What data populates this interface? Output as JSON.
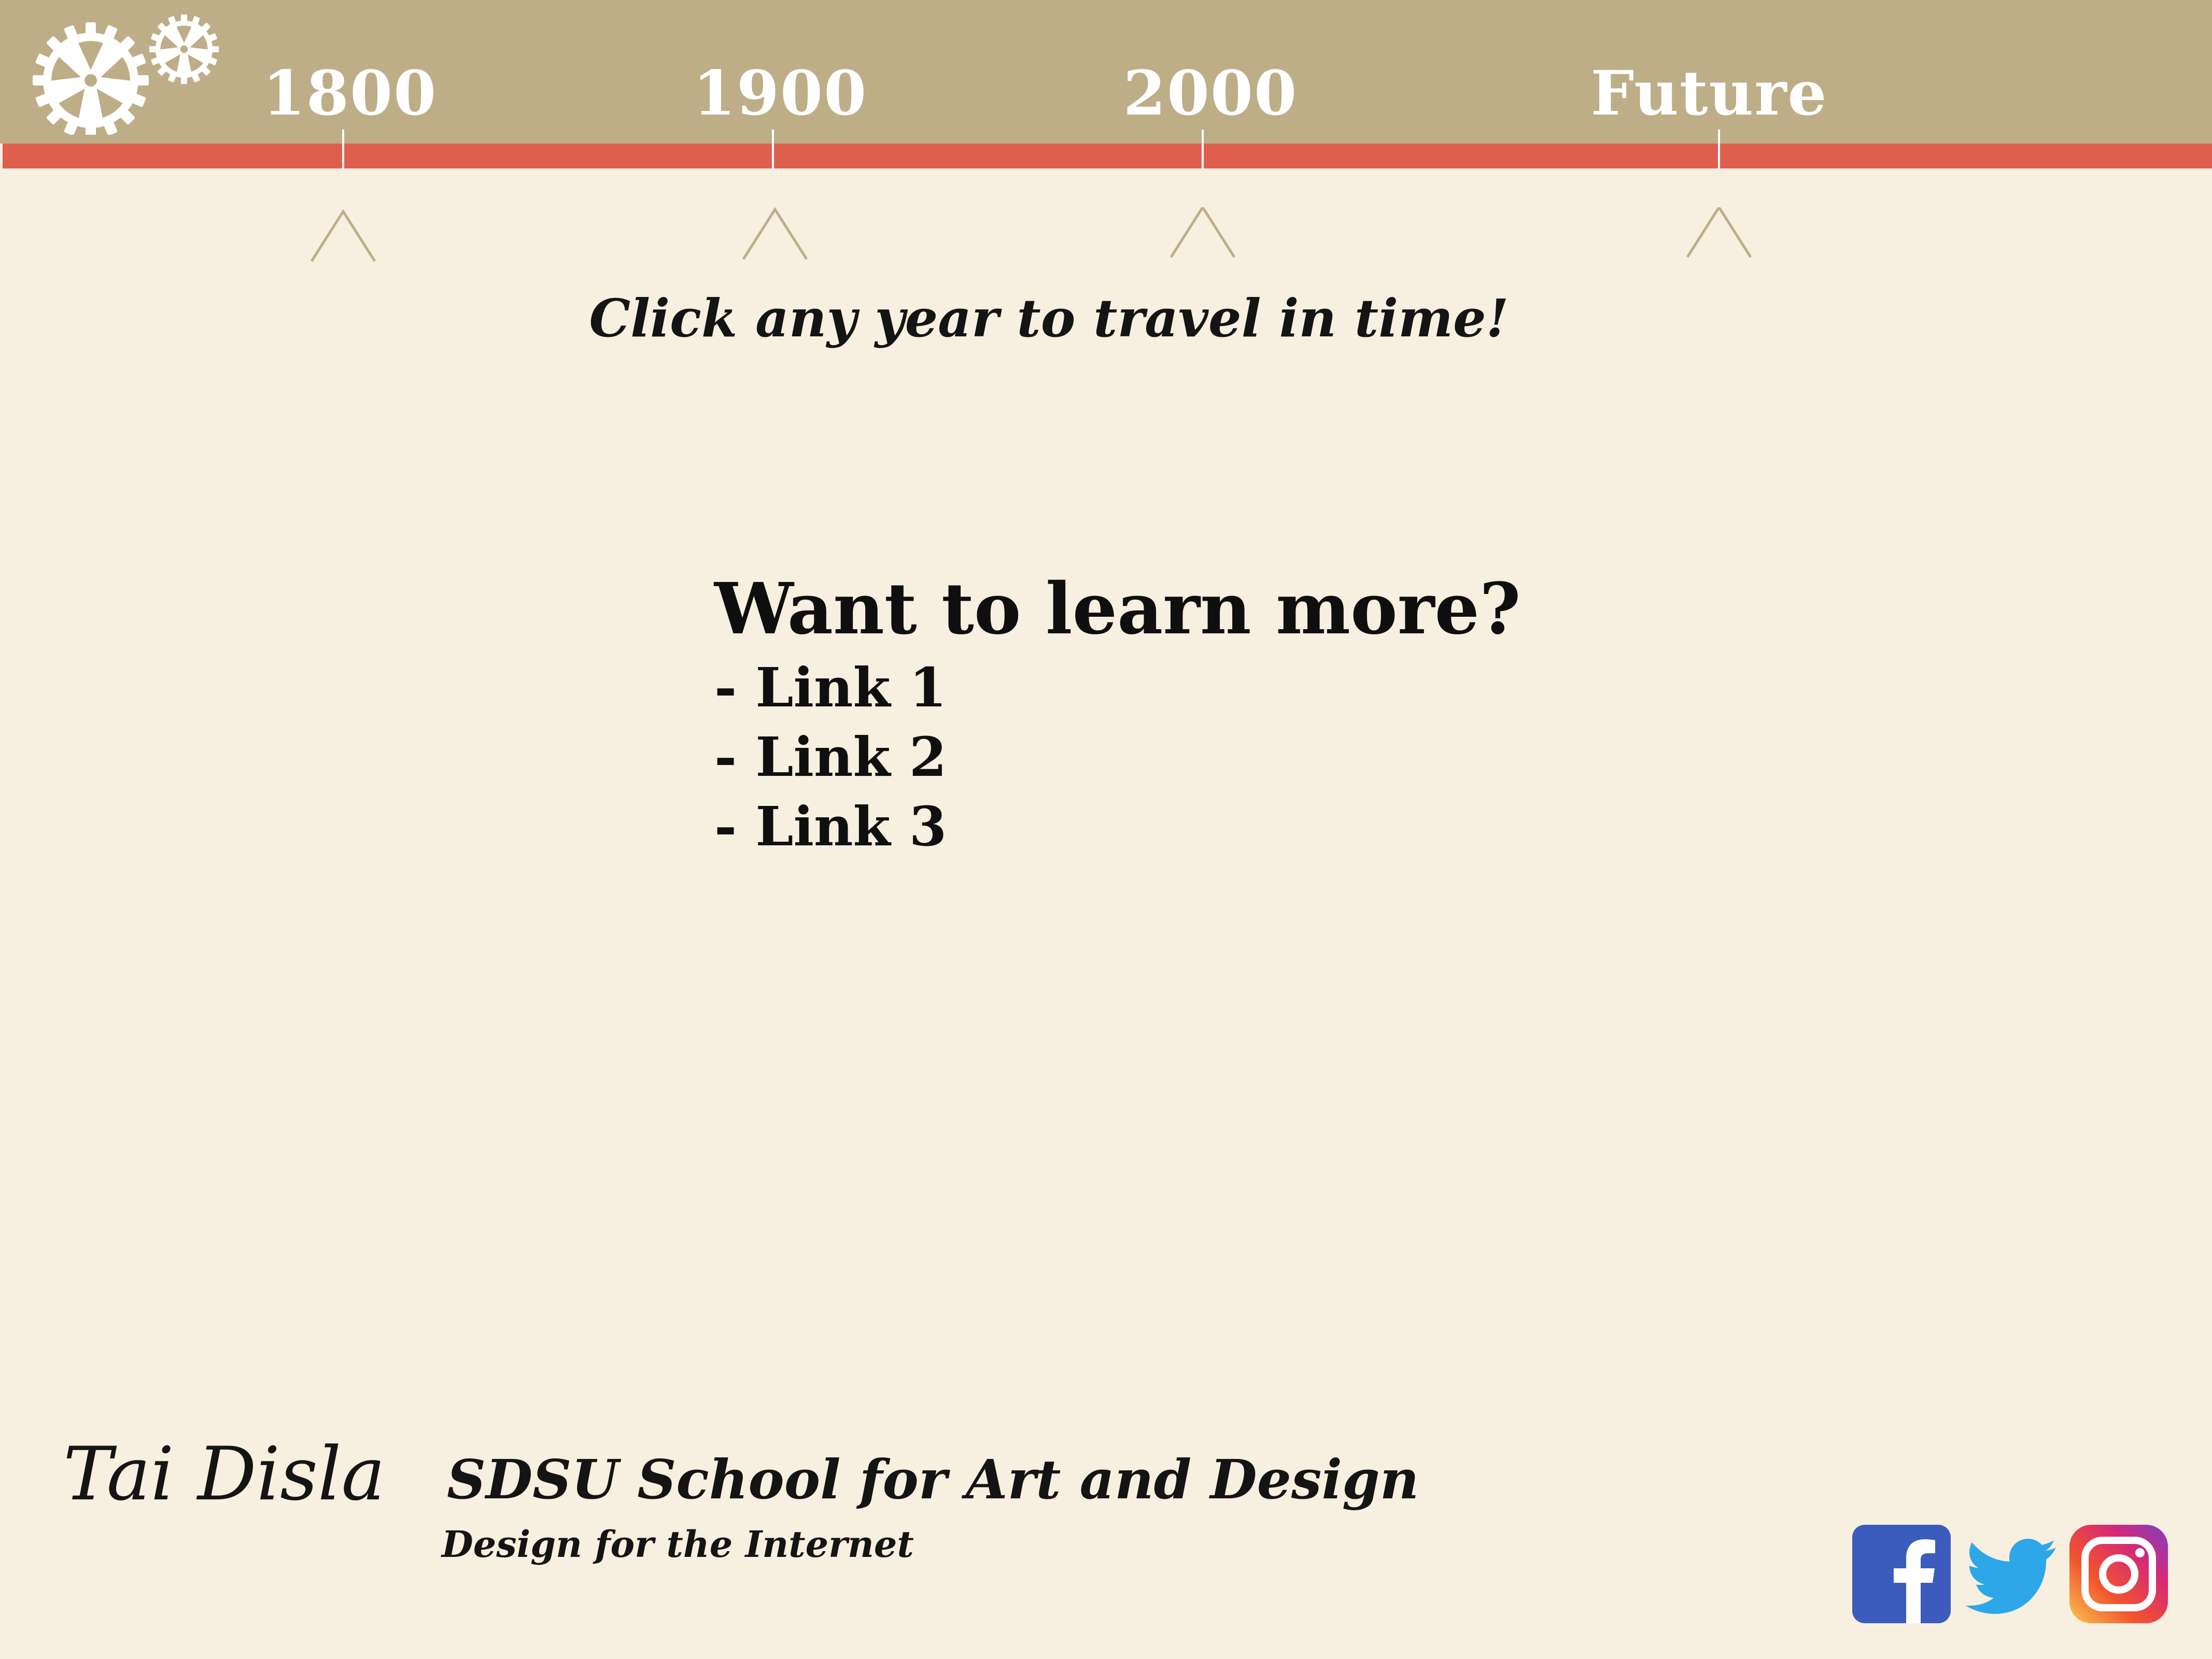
{
  "header": {
    "timeline": [
      {
        "label": "1800"
      },
      {
        "label": "1900"
      },
      {
        "label": "2000"
      },
      {
        "label": "Future"
      }
    ]
  },
  "hint": "Click any year to travel in time!",
  "learn_more": {
    "title": "Want to learn more?",
    "links": [
      "- Link 1",
      "- Link 2",
      "- Link 3"
    ]
  },
  "footer": {
    "author": "Tai Disla",
    "school": "SDSU School for Art and Design",
    "course": "Design for the Internet",
    "social": [
      {
        "icon": "facebook-icon"
      },
      {
        "icon": "twitter-icon"
      },
      {
        "icon": "instagram-icon"
      }
    ]
  },
  "colors": {
    "background": "#f7efdf",
    "header": "#bdae88",
    "accent_bar": "#df5f4f",
    "facebook": "#3b5bbd",
    "twitter": "#2ea7e8"
  }
}
